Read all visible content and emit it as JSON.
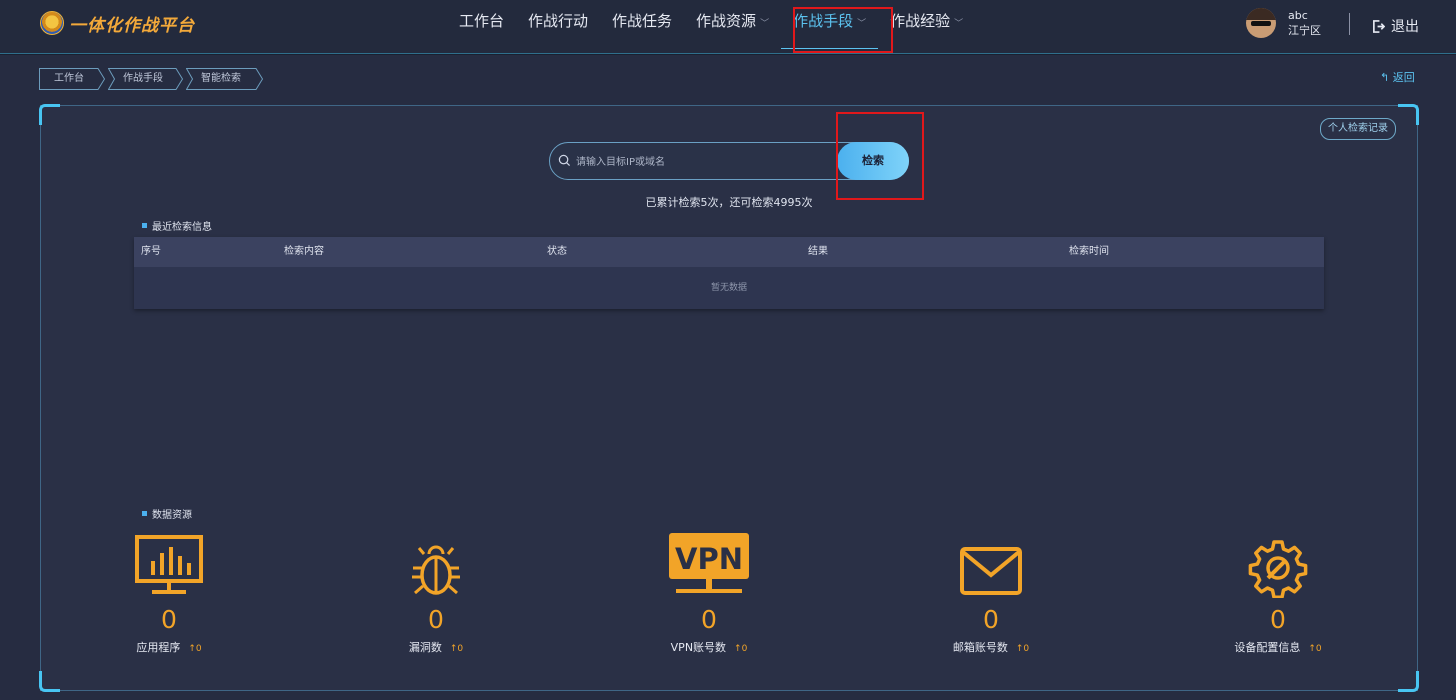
{
  "app": {
    "title": "一体化作战平台"
  },
  "nav": {
    "items": [
      {
        "label": "工作台"
      },
      {
        "label": "作战行动"
      },
      {
        "label": "作战任务"
      },
      {
        "label": "作战资源",
        "caret": "﹀"
      },
      {
        "label": "作战手段",
        "caret": "﹀",
        "active": true
      },
      {
        "label": "作战经验",
        "caret": "﹀"
      }
    ]
  },
  "user": {
    "name": "abc",
    "district": "江宁区",
    "logout_label": "退出"
  },
  "breadcrumb": [
    "工作台",
    "作战手段",
    "智能检索"
  ],
  "back_label": "返回",
  "search": {
    "placeholder": "请输入目标IP或域名",
    "button_label": "检索",
    "history_label": "个人检索记录",
    "stat_text": "已累计检索5次，还可检索4995次"
  },
  "recent": {
    "title": "最近检索信息",
    "columns": [
      "序号",
      "检索内容",
      "状态",
      "结果",
      "检索时间"
    ],
    "empty_text": "暂无数据"
  },
  "resources": {
    "title": "数据资源",
    "items": [
      {
        "icon": "monitor-chart-icon",
        "value": "0",
        "label": "应用程序",
        "delta": "↑0"
      },
      {
        "icon": "bug-icon",
        "value": "0",
        "label": "漏洞数",
        "delta": "↑0"
      },
      {
        "icon": "vpn-icon",
        "icon_text": "VPN",
        "value": "0",
        "label": "VPN账号数",
        "delta": "↑0"
      },
      {
        "icon": "mail-icon",
        "value": "0",
        "label": "邮箱账号数",
        "delta": "↑0"
      },
      {
        "icon": "gear-wrench-icon",
        "value": "0",
        "label": "设备配置信息",
        "delta": "↑0"
      }
    ]
  },
  "colors": {
    "accent": "#5cc3f0",
    "highlight": "#e0181b",
    "stat": "#f2a428",
    "logo": "#f3a93a"
  }
}
